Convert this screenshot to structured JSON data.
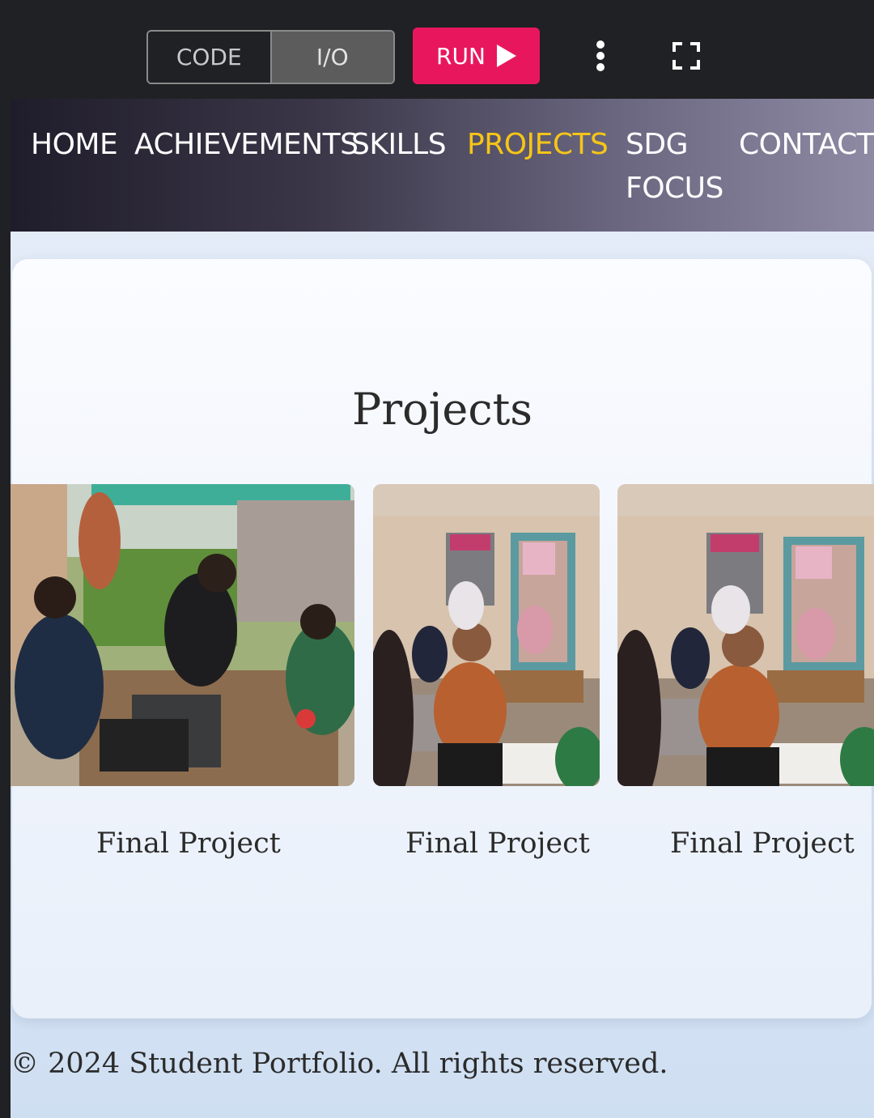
{
  "toolbar": {
    "code_label": "CODE",
    "io_label": "I/O",
    "run_label": "RUN",
    "accent_color": "#e8175d"
  },
  "nav": {
    "items": [
      {
        "label": "HOME"
      },
      {
        "label": "ACHIEVEMENTS"
      },
      {
        "label": "SKILLS"
      },
      {
        "label": "PROJECTS",
        "active": true
      },
      {
        "label": "SDG FOCUS"
      },
      {
        "label": "CONTACT"
      }
    ],
    "active_color": "#f5c518"
  },
  "projects": {
    "title": "Projects",
    "items": [
      {
        "caption": "Final Project",
        "image": "group-working-outdoors-photo"
      },
      {
        "caption": "Final Project",
        "image": "group-selfie-porch-photo"
      },
      {
        "caption": "Final Project",
        "image": "group-selfie-porch-photo"
      }
    ]
  },
  "footer": {
    "text": "© 2024 Student Portfolio. All rights reserved."
  }
}
